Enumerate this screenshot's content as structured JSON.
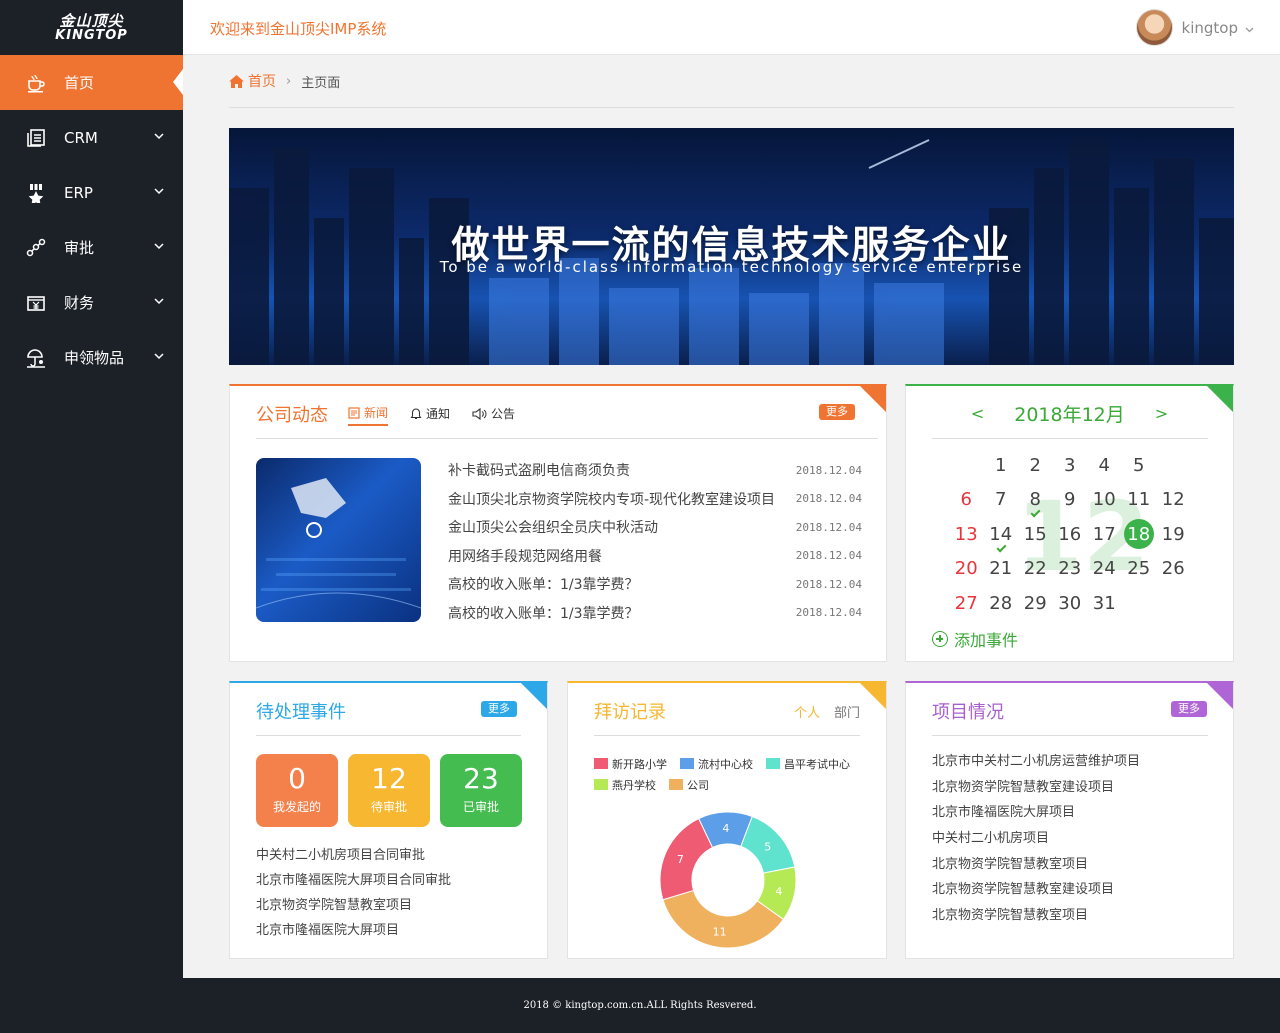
{
  "app": {
    "logo_cn": "金山顶尖",
    "logo_en": "KINGTOP",
    "welcome": "欢迎来到金山顶尖IMP系统",
    "username": "kingtop"
  },
  "sidebar": {
    "items": [
      {
        "label": "首页",
        "icon": "coffee-icon"
      },
      {
        "label": "CRM",
        "icon": "list-icon"
      },
      {
        "label": "ERP",
        "icon": "star-medal-icon"
      },
      {
        "label": "审批",
        "icon": "flow-icon"
      },
      {
        "label": "财务",
        "icon": "yen-icon"
      },
      {
        "label": "申领物品",
        "icon": "umbrella-icon"
      }
    ]
  },
  "breadcrumb": {
    "home": "首页",
    "current": "主页面"
  },
  "banner": {
    "title": "做世界一流的信息技术服务企业",
    "subtitle": "To be a world-class information technology service enterprise"
  },
  "news": {
    "title": "公司动态",
    "tabs": [
      "新闻",
      "通知",
      "公告"
    ],
    "more": "更多",
    "items": [
      {
        "title": "补卡截码式盗刷电信商须负责",
        "date": "2018.12.04"
      },
      {
        "title": "金山顶尖北京物资学院校内专项-现代化教室建设项目",
        "date": "2018.12.04"
      },
      {
        "title": "金山顶尖公会组织全员庆中秋活动",
        "date": "2018.12.04"
      },
      {
        "title": "用网络手段规范网络用餐",
        "date": "2018.12.04"
      },
      {
        "title": "高校的收入账单：1/3靠学费？",
        "date": "2018.12.04"
      },
      {
        "title": "高校的收入账单：1/3靠学费？",
        "date": "2018.12.04"
      }
    ]
  },
  "calendar": {
    "prev": "<",
    "next": ">",
    "month_label": "2018年12月",
    "big_month": "12",
    "weeks": [
      [
        "",
        "",
        "",
        "",
        "",
        "1",
        "2"
      ],
      [
        "3",
        "4",
        "5",
        "6",
        "7",
        "8",
        "9"
      ]
    ],
    "rows": [
      [
        "",
        "1",
        "2",
        "3",
        "4",
        "5",
        ""
      ],
      [
        "6",
        "7",
        "8",
        "9",
        "10",
        "11",
        "12"
      ],
      [
        "13",
        "14",
        "15",
        "16",
        "17",
        "18",
        "19"
      ],
      [
        "20",
        "21",
        "22",
        "23",
        "24",
        "25",
        "26"
      ],
      [
        "27",
        "28",
        "29",
        "30",
        "31",
        "",
        ""
      ]
    ],
    "today": "18",
    "event_days": [
      "8",
      "14"
    ],
    "add_event": "添加事件"
  },
  "pending": {
    "title": "待处理事件",
    "more": "更多",
    "stats": [
      {
        "value": "0",
        "label": "我发起的",
        "color": "#f4804c"
      },
      {
        "value": "12",
        "label": "待审批",
        "color": "#f7b731"
      },
      {
        "value": "23",
        "label": "已审批",
        "color": "#44bc4f"
      }
    ],
    "items": [
      "中关村二小机房项目合同审批",
      "北京市隆福医院大屏项目合同审批",
      "北京物资学院智慧教室项目",
      "北京市隆福医院大屏项目"
    ]
  },
  "visits": {
    "title": "拜访记录",
    "tabs": [
      "个人",
      "部门"
    ],
    "colors": {
      "accent": "#f7b731"
    }
  },
  "chart_data": {
    "type": "pie",
    "categories": [
      "新开路小学",
      "流村中心校",
      "昌平考试中心",
      "燕丹学校",
      "公司"
    ],
    "values": [
      7,
      4,
      5,
      4,
      11
    ],
    "colors": [
      "#ef5b73",
      "#5c9ee8",
      "#5fe3cf",
      "#b6ea55",
      "#f0b15f"
    ],
    "donut": true
  },
  "projects": {
    "title": "项目情况",
    "more": "更多",
    "items": [
      "北京市中关村二小机房运营维护项目",
      "北京物资学院智慧教室建设项目",
      "北京市隆福医院大屏项目",
      "中关村二小机房项目",
      "北京物资学院智慧教室项目",
      "北京物资学院智慧教室建设项目",
      "北京物资学院智慧教室项目"
    ]
  },
  "footer": {
    "text": "2018 © kingtop.com.cn.ALL Rights Resvered."
  }
}
